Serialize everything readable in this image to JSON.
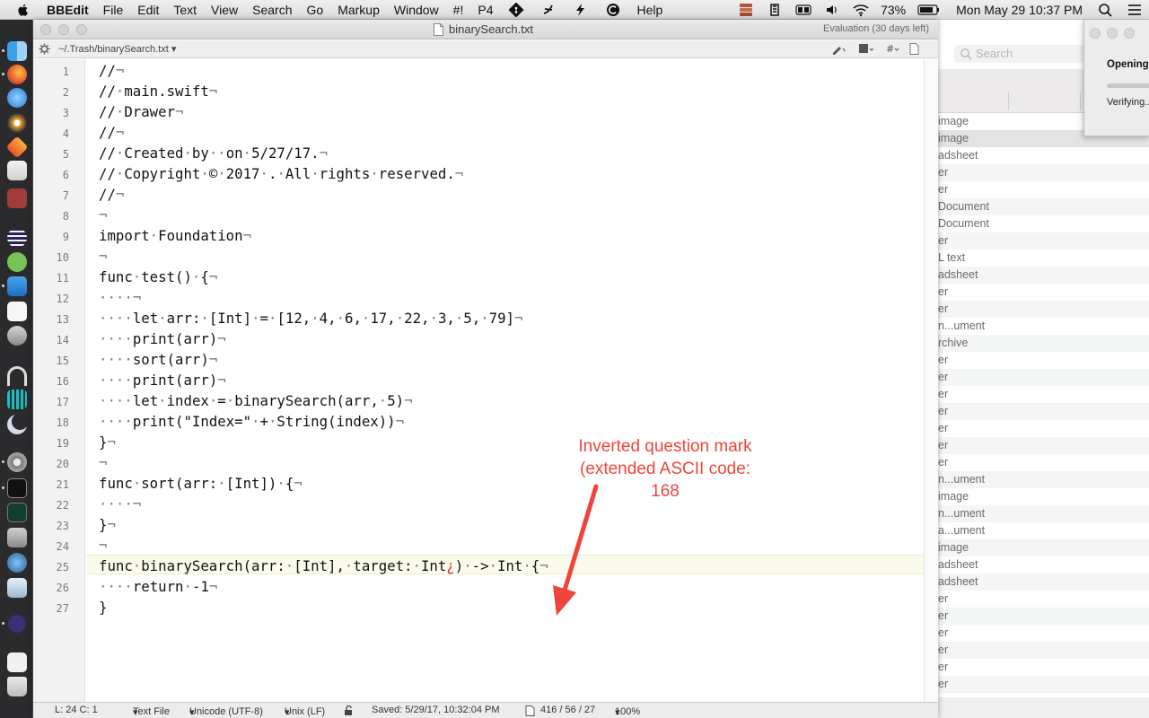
{
  "menubar": {
    "app_name": "BBEdit",
    "items": [
      "File",
      "Edit",
      "Text",
      "View",
      "Search",
      "Go",
      "Markup",
      "Window",
      "#!",
      "P4"
    ],
    "help": "Help",
    "battery": "73%",
    "clock": "Mon May 29  10:37 PM"
  },
  "window": {
    "title": "binarySearch.txt",
    "evaluation": "Evaluation (30 days left)",
    "path": "~/.Trash/binarySearch.txt",
    "path_chevron": "▾"
  },
  "code": {
    "line_numbers": [
      "1",
      "2",
      "3",
      "4",
      "5",
      "6",
      "7",
      "8",
      "9",
      "10",
      "11",
      "12",
      "13",
      "14",
      "15",
      "16",
      "17",
      "18",
      "19",
      "20",
      "21",
      "22",
      "23",
      "24",
      "25",
      "26",
      "27"
    ]
  },
  "annotation": {
    "line1": "Inverted question mark",
    "line2": "(extended ASCII code:",
    "line3": "168"
  },
  "statusbar": {
    "position": "L: 24 C: 1",
    "language": "Text File",
    "encoding": "Unicode (UTF-8)",
    "line_endings": "Unix (LF)",
    "saved": "Saved: 5/29/17, 10:32:04 PM",
    "stats": "416 / 56 / 27",
    "zoom": "100%"
  },
  "background_window": {
    "search_placeholder": "Search",
    "rows": [
      "image",
      "image",
      "adsheet",
      "er",
      "er",
      "Document",
      "Document",
      "er",
      "L text",
      "adsheet",
      "er",
      "er",
      "n...ument",
      "rchive",
      "er",
      "er",
      "er",
      "er",
      "er",
      "er",
      "er",
      "n...ument",
      "image",
      "n...ument",
      "a...ument",
      "image",
      "adsheet",
      "adsheet",
      "er",
      "er",
      "er",
      "er",
      "er",
      "er"
    ]
  },
  "dialog": {
    "title": "Opening",
    "status": "Verifying..."
  },
  "colors": {
    "annotation": "#f0443a",
    "current_line": "#fbfbec",
    "invisibles": "#7a7a7a"
  }
}
